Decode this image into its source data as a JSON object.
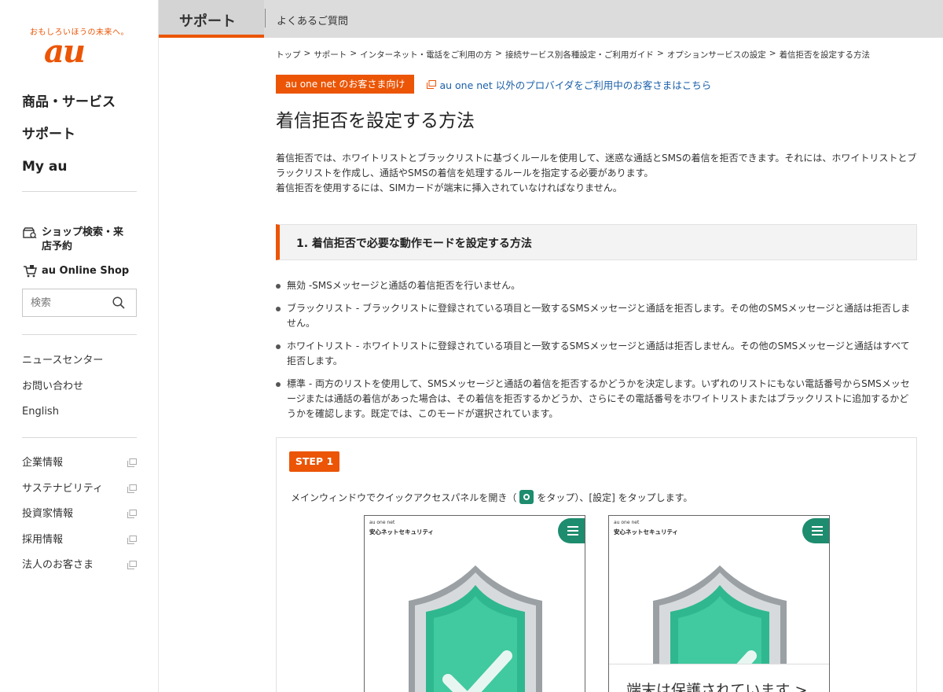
{
  "brand": {
    "tagline": "おもしろいほうの未来へ。",
    "logo": "au",
    "accent": "#eb5505"
  },
  "sidebar": {
    "main_nav": [
      "商品・サービス",
      "サポート",
      "My au"
    ],
    "shop_search": "ショップ検索・来店予約",
    "online_shop": "au Online Shop",
    "search_placeholder": "検索",
    "sub_nav": [
      "ニュースセンター",
      "お問い合わせ",
      "English"
    ],
    "external_nav": [
      "企業情報",
      "サステナビリティ",
      "投資家情報",
      "採用情報",
      "法人のお客さま"
    ]
  },
  "header": {
    "active_section": "サポート",
    "faq_link": "よくあるご質問"
  },
  "breadcrumb": [
    "トップ",
    "サポート",
    "インターネット・電話をご利用の方",
    "接続サービス別各種設定・ご利用ガイド",
    "オプションサービスの設定",
    "着信拒否を設定する方法"
  ],
  "breadcrumb_separator": ">",
  "main": {
    "customer_tag": "au one net のお客さま向け",
    "alt_provider_link": "au one net 以外のプロバイダをご利用中のお客さまはこちら",
    "title": "着信拒否を設定する方法",
    "intro_1": "着信拒否では、ホワイトリストとブラックリストに基づくルールを使用して、迷惑な通話とSMSの着信を拒否できます。それには、ホワイトリストとブラックリストを作成し、通話やSMSの着信を処理するルールを指定する必要があります。",
    "intro_2": "着信拒否を使用するには、SIMカードが端末に挿入されていなければなりません。",
    "section_title": "1. 着信拒否で必要な動作モードを設定する方法",
    "modes": [
      "無効 -SMSメッセージと通話の着信拒否を行いません。",
      "ブラックリスト - ブラックリストに登録されている項目と一致するSMSメッセージと通話を拒否します。その他のSMSメッセージと通話は拒否しません。",
      "ホワイトリスト - ホワイトリストに登録されている項目と一致するSMSメッセージと通話は拒否しません。その他のSMSメッセージと通話はすべて拒否します。",
      "標準 - 両方のリストを使用して、SMSメッセージと通話の着信を拒否するかどうかを決定します。いずれのリストにもない電話番号からSMSメッセージまたは通話の着信があった場合は、その着信を拒否するかどうか、さらにその電話番号をホワイトリストまたはブラックリストに追加するかどうかを確認します。既定では、このモードが選択されています。"
    ],
    "step": {
      "badge": "STEP 1",
      "text_before": "メインウィンドウでクイックアクセスパネルを開き（",
      "text_after": "をタップ）、[設定] をタップします。"
    },
    "screens": [
      {
        "brand": "au one net",
        "app": "安心ネットセキュリティ",
        "banner": ""
      },
      {
        "brand": "au one net",
        "app": "安心ネットセキュリティ",
        "banner": "端末は保護されています >"
      }
    ]
  }
}
